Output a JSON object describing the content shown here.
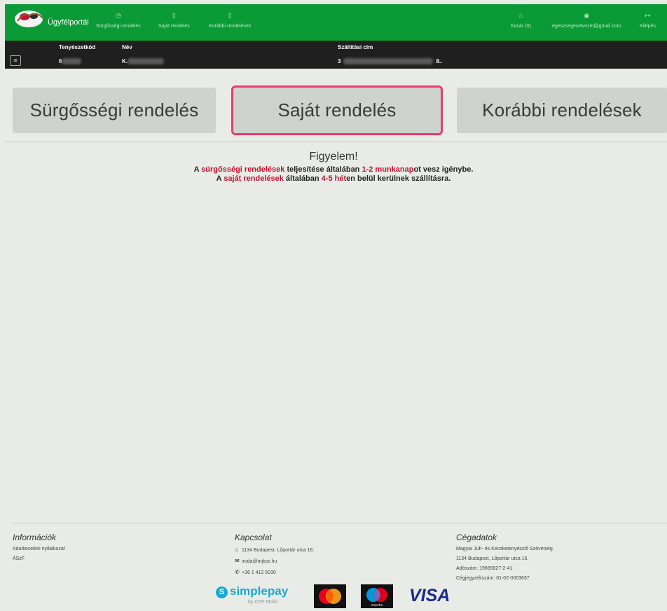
{
  "nav": {
    "brand": "Ügyfélportál",
    "items": [
      {
        "label": "Sürgősségi rendelés",
        "icon": "clock-icon"
      },
      {
        "label": "Saját rendelés",
        "icon": "document-icon"
      },
      {
        "label": "Korábbi rendelések",
        "icon": "document-icon"
      }
    ],
    "cart": "Kosár (0)",
    "email": "egeszsegeselvezet@gmail.com",
    "logout": "Kilépés"
  },
  "userbar": {
    "col1_header": "Tenyészetkód",
    "col1_value": "6",
    "col2_header": "Név",
    "col2_value": "K.",
    "col3_header": "Szállítási cím",
    "col3_value_start": "3",
    "col3_value_end": "8.."
  },
  "buttons": {
    "urgent": "Sürgősségi rendelés",
    "own": "Saját rendelés",
    "previous": "Korábbi rendelések"
  },
  "notice": {
    "title": "Figyelem!",
    "l1_a": "A ",
    "l1_b": "sürgősségi rendelések",
    "l1_c": " teljesítése általában ",
    "l1_d": "1-2 munkanap",
    "l1_e": "ot vesz igénybe.",
    "l2_a": "A ",
    "l2_b": "saját rendelések",
    "l2_c": " általában ",
    "l2_d": "4-5 hét",
    "l2_e": "en belül kerülnek szállításra."
  },
  "footer": {
    "info_title": "Információk",
    "info_links": [
      "Adatkezelési nyilatkozat",
      "ÁSzF"
    ],
    "contact_title": "Kapcsolat",
    "address": "1134 Budapest, Lőportár utca 16.",
    "email": "iroda@mjksz.hu",
    "phone": "+36 1 412 5030",
    "company_title": "Cégadatok",
    "company_name": "Magyar Juh- és Kecsketenyésztő Szövetség",
    "company_address": "1134 Budapest, Lőportár utca 16.",
    "tax_id": "Adószám: 19665827-2-41",
    "reg_no": "Cégjegyzékszám: 01-02-0003637",
    "simplepay": "simplepay",
    "simplepay_by": "by OTP Mobil",
    "visa": "VISA",
    "maestro": "maestro"
  },
  "colors": {
    "nav_green": "#0a9a36",
    "accent_red": "#c8102e",
    "active_border": "#ec3a72"
  }
}
